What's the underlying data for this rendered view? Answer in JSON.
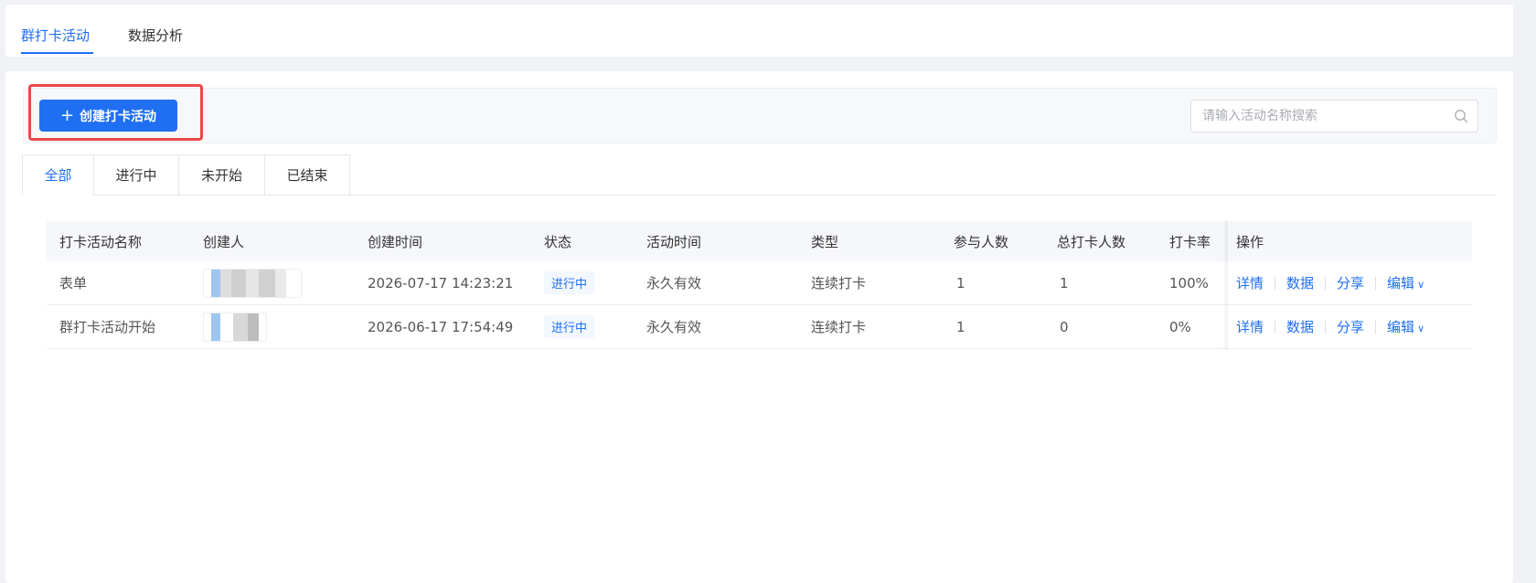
{
  "top_tabs": [
    "群打卡活动",
    "数据分析"
  ],
  "toolbar": {
    "create_label": "创建打卡活动",
    "search_placeholder": "请输入活动名称搜索"
  },
  "sub_tabs": [
    "全部",
    "进行中",
    "未开始",
    "已结束"
  ],
  "table": {
    "headers": [
      "打卡活动名称",
      "创建人",
      "创建时间",
      "状态",
      "活动时间",
      "类型",
      "参与人数",
      "总打卡人数",
      "打卡率",
      "操作"
    ],
    "rows": [
      {
        "name": "表单",
        "created_at": "2026-07-17 14:23:21",
        "status": "进行中",
        "period": "永久有效",
        "type": "连续打卡",
        "participants": "1",
        "total_checkins": "1",
        "rate": "100%"
      },
      {
        "name": "群打卡活动开始",
        "created_at": "2026-06-17 17:54:49",
        "status": "进行中",
        "period": "永久有效",
        "type": "连续打卡",
        "participants": "1",
        "total_checkins": "0",
        "rate": "0%"
      }
    ],
    "actions": [
      "详情",
      "数据",
      "分享",
      "编辑"
    ]
  },
  "colors": {
    "primary": "#1f6ff2",
    "highlight": "#e84a4a"
  }
}
